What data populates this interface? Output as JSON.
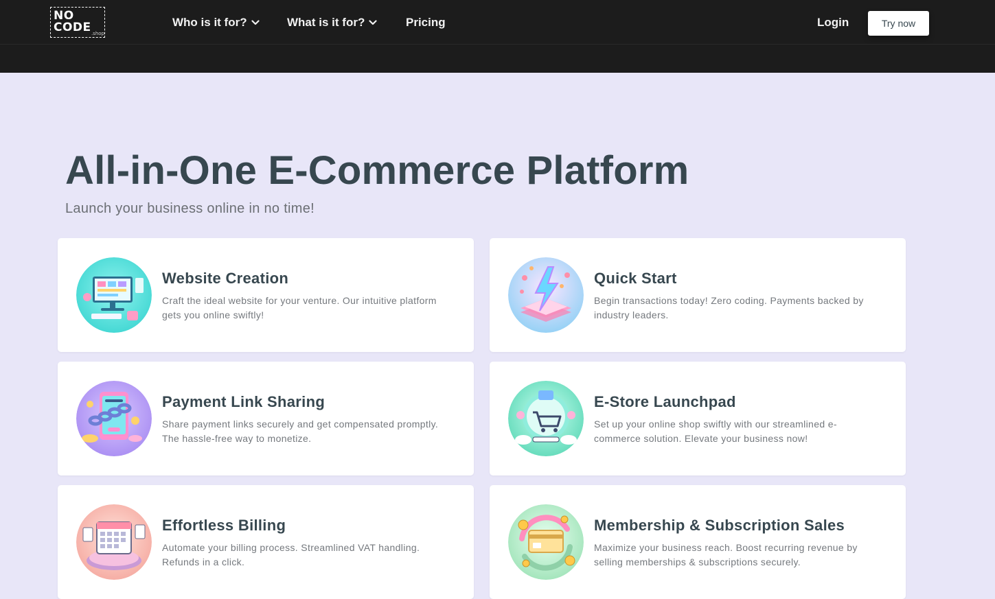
{
  "logo": {
    "line1": "NO",
    "line2": "CODE",
    "suffix": ".shop"
  },
  "nav": {
    "who": "Who is it for?",
    "what": "What is it for?",
    "pricing": "Pricing",
    "login": "Login",
    "try_now": "Try now"
  },
  "hero": {
    "title": "All-in-One E-Commerce Platform",
    "subtitle": "Launch your business online in no time!"
  },
  "features": [
    {
      "title": "Website Creation",
      "desc": "Craft the ideal website for your venture. Our intuitive platform gets you online swiftly!",
      "icon": "website-illustration-icon"
    },
    {
      "title": "Quick Start",
      "desc": "Begin transactions today! Zero coding. Payments backed by industry leaders.",
      "icon": "lightning-illustration-icon"
    },
    {
      "title": "Payment Link Sharing",
      "desc": "Share payment links securely and get compensated promptly. The hassle-free way to monetize.",
      "icon": "payment-link-illustration-icon"
    },
    {
      "title": "E-Store Launchpad",
      "desc": "Set up your online shop swiftly with our streamlined e-commerce solution. Elevate your business now!",
      "icon": "shopping-cart-illustration-icon"
    },
    {
      "title": "Effortless Billing",
      "desc": "Automate your billing process. Streamlined VAT handling. Refunds in a click.",
      "icon": "calendar-billing-illustration-icon"
    },
    {
      "title": "Membership & Subscription Sales",
      "desc": "Maximize your business reach. Boost recurring revenue by selling memberships & subscriptions securely.",
      "icon": "membership-card-illustration-icon"
    }
  ],
  "colors": {
    "topbar": "#1c1c1c",
    "page_background": "#e8e6f8",
    "heading": "#37474f",
    "body_text": "#74787d"
  }
}
